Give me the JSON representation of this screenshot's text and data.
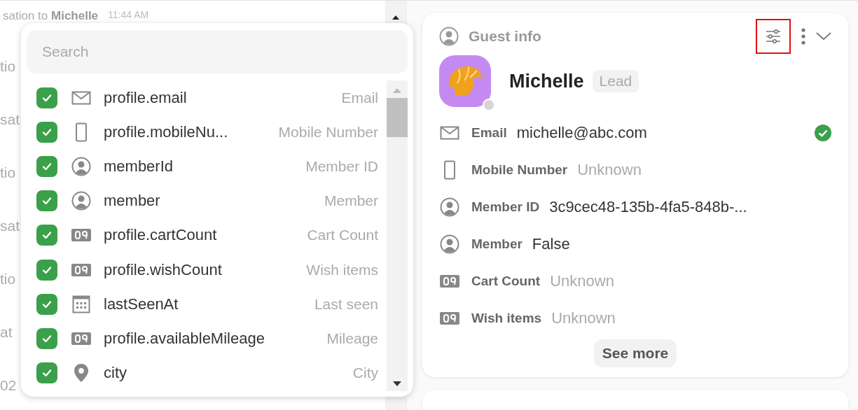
{
  "background_list": {
    "top_line": {
      "prefix": "sation to",
      "name": "Michelle",
      "time": "11:44 AM"
    },
    "fragments": [
      "tio",
      "sat",
      "tio",
      "sat",
      "tio",
      "at",
      "02"
    ]
  },
  "field_picker": {
    "search": {
      "placeholder": "Search"
    },
    "items": [
      {
        "key": "profile.email",
        "label": "Email",
        "kind": "mail",
        "checked": true
      },
      {
        "key": "profile.mobileNu...",
        "label": "Mobile Number",
        "kind": "phone",
        "checked": true
      },
      {
        "key": "memberId",
        "label": "Member ID",
        "kind": "person",
        "checked": true
      },
      {
        "key": "member",
        "label": "Member",
        "kind": "person",
        "checked": true
      },
      {
        "key": "profile.cartCount",
        "label": "Cart Count",
        "kind": "number",
        "checked": true
      },
      {
        "key": "profile.wishCount",
        "label": "Wish items",
        "kind": "number",
        "checked": true
      },
      {
        "key": "lastSeenAt",
        "label": "Last seen",
        "kind": "calendar",
        "checked": true
      },
      {
        "key": "profile.availableMileage",
        "label": "Mileage",
        "kind": "number",
        "checked": true
      },
      {
        "key": "city",
        "label": "City",
        "kind": "pin",
        "checked": true
      }
    ]
  },
  "guest_info": {
    "title": "Guest info",
    "filter_highlighted": true,
    "name": "Michelle",
    "badge": "Lead",
    "online": false,
    "fields": [
      {
        "kind": "mail",
        "label": "Email",
        "value": "michelle@abc.com",
        "muted": false,
        "verified": true
      },
      {
        "kind": "phone",
        "label": "Mobile Number",
        "value": "Unknown",
        "muted": true,
        "verified": false
      },
      {
        "kind": "person",
        "label": "Member ID",
        "value": "3c9cec48-135b-4fa5-848b-...",
        "muted": false,
        "verified": false
      },
      {
        "kind": "person",
        "label": "Member",
        "value": "False",
        "muted": false,
        "verified": false
      },
      {
        "kind": "number",
        "label": "Cart Count",
        "value": "Unknown",
        "muted": true,
        "verified": false
      },
      {
        "kind": "number",
        "label": "Wish items",
        "value": "Unknown",
        "muted": true,
        "verified": false
      }
    ],
    "see_more": "See more"
  }
}
